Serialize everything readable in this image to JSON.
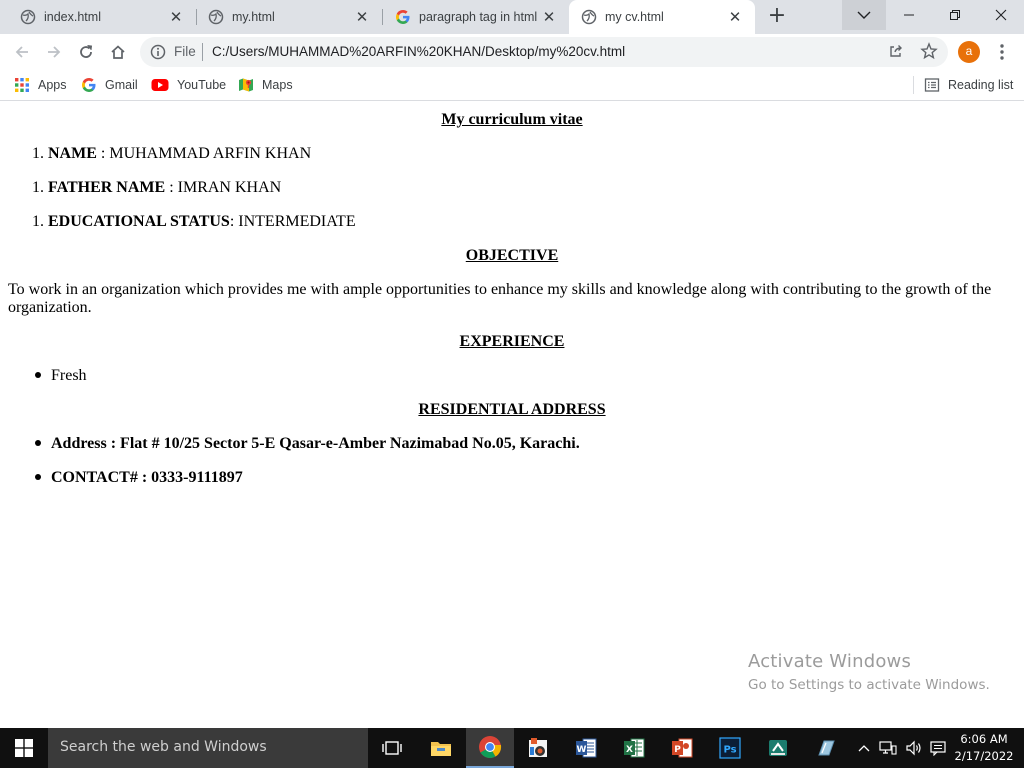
{
  "browser": {
    "tabs": [
      {
        "title": "index.html",
        "icon": "globe-icon",
        "active": false
      },
      {
        "title": "my.html",
        "icon": "globe-icon",
        "active": false
      },
      {
        "title": "paragraph tag in html -",
        "icon": "google-icon",
        "active": false
      },
      {
        "title": "my cv.html",
        "icon": "globe-icon",
        "active": true
      }
    ],
    "omnibox": {
      "scheme_label": "File",
      "url": "C:/Users/MUHAMMAD%20ARFIN%20KHAN/Desktop/my%20cv.html"
    },
    "profile_initial": "a",
    "bookmarks": [
      {
        "label": "Apps",
        "icon": "apps-grid-icon"
      },
      {
        "label": "Gmail",
        "icon": "google-icon"
      },
      {
        "label": "YouTube",
        "icon": "youtube-icon"
      },
      {
        "label": "Maps",
        "icon": "maps-icon"
      }
    ],
    "reading_list": "Reading list"
  },
  "page": {
    "heading": "My curriculum vitae",
    "details": [
      {
        "number": "1.",
        "label": "NAME",
        "value": " : MUHAMMAD ARFIN KHAN"
      },
      {
        "number": "1.",
        "label": "FATHER NAME",
        "value": " : IMRAN KHAN"
      },
      {
        "number": "1.",
        "label": "EDUCATIONAL STATUS",
        "value": ": INTERMEDIATE"
      }
    ],
    "objective_heading": "OBJECTIVE",
    "objective_text": "To work in an organization which provides me with ample opportunities to enhance my skills and knowledge along with contributing to the growth of the organization.",
    "experience_heading": "EXPERIENCE",
    "experience_items": [
      "Fresh"
    ],
    "address_heading": "RESIDENTIAL ADDRESS",
    "address_items": [
      "Address : Flat # 10/25 Sector 5-E Qasar-e-Amber Nazimabad No.05, Karachi.",
      "CONTACT# : 0333-9111897"
    ]
  },
  "watermark": {
    "title": "Activate Windows",
    "subtitle": "Go to Settings to activate Windows."
  },
  "taskbar": {
    "search_placeholder": "Search the web and Windows",
    "time": "6:06 AM",
    "date": "2/17/2022"
  }
}
